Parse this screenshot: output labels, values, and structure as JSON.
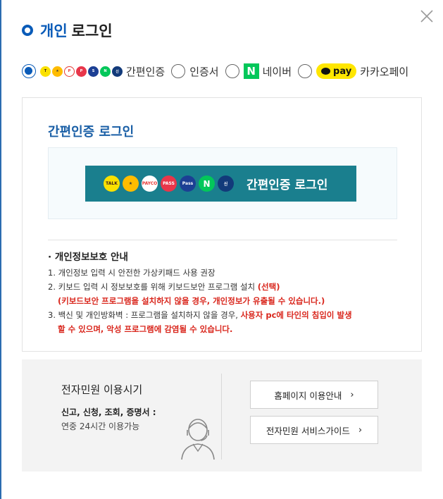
{
  "header": {
    "title_highlight": "개인",
    "title_rest": "로그인",
    "accent_color": "#0a5bb8"
  },
  "methods": [
    {
      "label": "간편인증",
      "selected": true
    },
    {
      "label": "인증서",
      "selected": false
    },
    {
      "label": "네이버",
      "selected": false,
      "icon": "naver-n-icon"
    },
    {
      "label": "카카오페이",
      "selected": false,
      "icon": "kakaopay-icon"
    }
  ],
  "naver_logo": "N",
  "kakaopay_logo": "pay",
  "simple_auth": {
    "section_title": "간편인증 로그인",
    "button_label": "간편인증 로그인",
    "button_color": "#1a7f8e",
    "provider_icons": [
      "talk",
      "kb",
      "payco",
      "pass",
      "samsung-pass",
      "naver",
      "shinhan"
    ],
    "provider_marks": {
      "talk": "TALK",
      "payco": "PAYCO",
      "pass": "PASS",
      "samsung_pass": "Pass",
      "naver": "N"
    }
  },
  "notice": {
    "title": "· 개인정보보호 안내",
    "item1": "1. 개인정보 입력 시 안전한 가상키패드 사용 권장",
    "item2_text": "2. 키보드 입력 시 정보보호를 위해 키보드보안 프로그램 설치",
    "item2_red": "(선택)",
    "item2_sub": "(키보드보안 프로그램을 설치하지 않을 경우, 개인정보가 유출될 수 있습니다.)",
    "item3_text": "3. 백신 및 개인방화벽 : 프로그램을 설치하지 않을 경우,",
    "item3_red": "사용자 pc에 타인의 침입이 발생",
    "item3_red2": "할 수 있으며, 악성 프로그램에 감염될 수 있습니다."
  },
  "footer": {
    "title": "전자민원 이용시기",
    "sub": "신고, 신청, 조회, 증명서 :",
    "desc": "연중 24시간 이용가능",
    "btn_homepage": "홈페이지 이용안내",
    "btn_guide": "전자민원 서비스가이드",
    "chevron": "›"
  }
}
